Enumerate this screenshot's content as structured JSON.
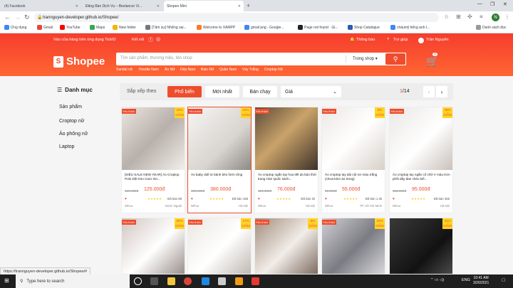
{
  "browser": {
    "tabs": [
      {
        "label": "(4) Facebook",
        "color": "#1877f2"
      },
      {
        "label": "Đăng Bán Dịch Vụ – Beelancer Vi...",
        "color": "#f5b400"
      },
      {
        "label": "Shopee Mini",
        "color": "#ee4d2d"
      }
    ],
    "url": "trannguyen-developer.github.io/Shopee/",
    "bookmarks": [
      {
        "label": "Ứng dụng",
        "color": "#4285f4"
      },
      {
        "label": "Gmail",
        "color": "#ea4335"
      },
      {
        "label": "YouTube",
        "color": "#ff0000"
      },
      {
        "label": "Maps",
        "color": "#34a853"
      },
      {
        "label": "New folder",
        "color": "#f4b400"
      },
      {
        "label": "[Tâm sự] Những sai...",
        "color": "#777777"
      },
      {
        "label": "Welcome to XAMPP",
        "color": "#fb7a24"
      },
      {
        "label": "gmail png - Google...",
        "color": "#4285f4"
      },
      {
        "label": "Page not found · Gi...",
        "color": "#222222"
      },
      {
        "label": "Shop Catalogue",
        "color": "#2a5db0"
      },
      {
        "label": "chàumỹ tiếng anh l...",
        "color": "#4285f4"
      }
    ],
    "reading_list": "Danh sách đọc",
    "profile_initial": "N",
    "status_url": "https://trannguyen-developer.github.io/Shopee/#"
  },
  "shopee": {
    "top_left_text": "Vào cửa hàng trên ứng dụng TickID",
    "connect_label": "Kết nối",
    "notifications": "Thông báo",
    "help": "Trợ giúp",
    "username": "Trần Nguyên",
    "logo_text": "Shopee",
    "logo_glyph": "S",
    "search_placeholder": "Tìm sản phẩm, thương hiệu, tên shop",
    "search_scope": "Trong shop",
    "search_hints": [
      "Sandal nữ",
      "Hoodie Nam",
      "Áo Nữ",
      "Dép Nam",
      "Balo Nữ",
      "Quần Nam",
      "Váy Trắng",
      "Croptop Nữ"
    ],
    "cart_count": "0",
    "brand_color": "#ee4d2d"
  },
  "sidebar": {
    "title": "Danh mục",
    "items": [
      "Sản phẩm",
      "Croptop nữ",
      "Áo phông nữ",
      "Laptop"
    ]
  },
  "sortbar": {
    "label": "Sắp xếp theo",
    "options": [
      "Phổ biến",
      "Mới nhất",
      "Bán chạy"
    ],
    "price_label": "Giá",
    "page_current": "1",
    "page_total": "/14"
  },
  "products": [
    {
      "badge": "Yêu thích",
      "discount": "10% GIẢM",
      "name": "[SIÊU SALE NEW YEAR] Áo Croptop Polo Dệt Kim Caro Xin...",
      "old_price": "150.000đ",
      "price": "125.000đ",
      "sold": "Đã bán 88",
      "ship": "Whoo",
      "location": "Nước Ngoài"
    },
    {
      "badge": "Yêu thích",
      "discount": "15% GIẢM",
      "name": "Áo baby doll tơ bánh bèo form rộng",
      "old_price": "400.000đ",
      "price": "380.000đ",
      "sold": "Đã bán 188",
      "ship": "Whoo",
      "location": "Hà Nội"
    },
    {
      "badge": "Yêu thích",
      "discount": "",
      "name": "Áo croptop ngắn tay hoa tiết da báo thời trang Hàn Quốc sành...",
      "old_price": "126.000đ",
      "price": "76.000đ",
      "sold": "Đã bán 2k",
      "ship": "Whoo",
      "location": "Hà Nội"
    },
    {
      "badge": "Yêu thích",
      "discount": "5% GIẢM",
      "name": "Áo croptop tay dài cột nơ màu trắng (chưa kèm áo trong)",
      "old_price": "65.000đ",
      "price": "55.000đ",
      "sold": "Đã bán 1.3k",
      "ship": "Whoo",
      "location": "TP. Hồ Chí Minh"
    },
    {
      "badge": "Yêu thích",
      "discount": "45% GIẢM",
      "name": "Áo croptop tay ngắn cổ chữ V màu trơn phối dây đan chéo kiể...",
      "old_price": "182.000đ",
      "price": "95.000đ",
      "sold": "Đã bán 455",
      "ship": "Whoo",
      "location": "Hà Nội"
    },
    {
      "badge": "Yêu thích",
      "discount": "50% GIẢM",
      "name": "",
      "old_price": "",
      "price": "",
      "sold": "",
      "ship": "",
      "location": ""
    },
    {
      "badge": "Yêu thích",
      "discount": "17% GIẢM",
      "name": "",
      "old_price": "",
      "price": "",
      "sold": "",
      "ship": "",
      "location": ""
    },
    {
      "badge": "Yêu thích",
      "discount": "8% GIẢM",
      "name": "",
      "old_price": "",
      "price": "",
      "sold": "",
      "ship": "",
      "location": ""
    },
    {
      "badge": "Yêu thích",
      "discount": "10% GIẢM",
      "name": "",
      "old_price": "",
      "price": "",
      "sold": "",
      "ship": "",
      "location": ""
    },
    {
      "badge": "",
      "discount": "31% GIẢM",
      "name": "",
      "old_price": "",
      "price": "",
      "sold": "",
      "ship": "",
      "location": ""
    }
  ],
  "taskbar": {
    "search_placeholder": "Type here to search",
    "language": "ENG",
    "time": "10:41 AM",
    "date": "3/26/2021"
  }
}
